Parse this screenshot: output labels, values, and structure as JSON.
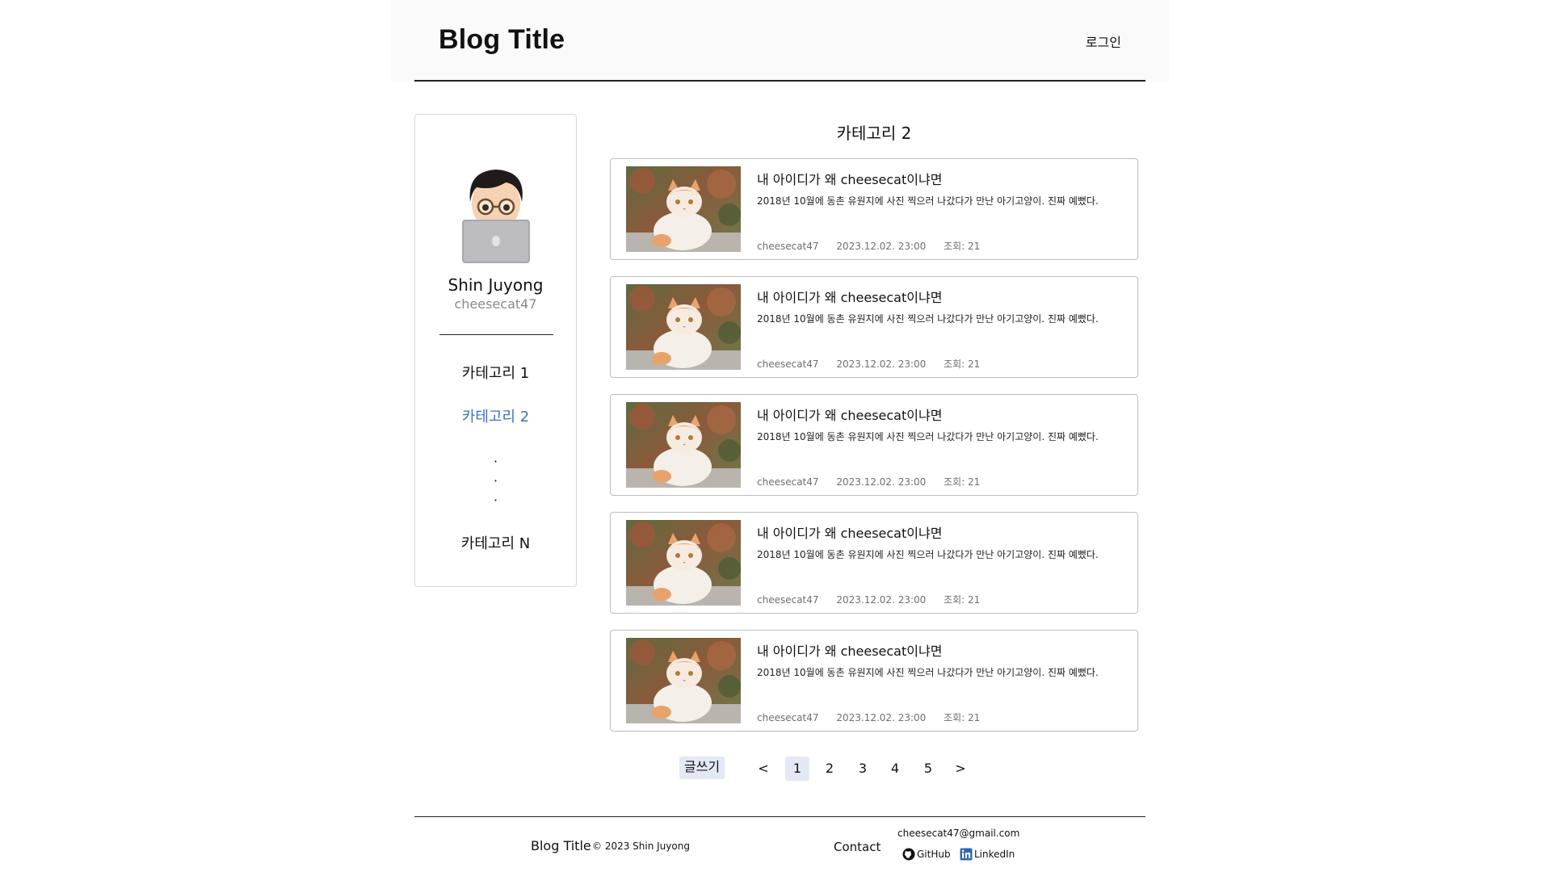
{
  "header": {
    "title": "Blog Title",
    "login_label": "로그인"
  },
  "sidebar": {
    "name": "Shin Juyong",
    "handle": "cheesecat47",
    "categories": [
      {
        "label": "카테고리 1",
        "active": false
      },
      {
        "label": "카테고리 2",
        "active": true
      },
      {
        "label": "카테고리 N",
        "active": false
      }
    ],
    "ellipsis": [
      "·",
      "·",
      "·"
    ]
  },
  "main": {
    "heading": "카테고리 2",
    "posts": [
      {
        "title": "내 아이디가 왜 cheesecat이냐면",
        "excerpt": "2018년 10월에 동촌 유원지에 사진 찍으러 나갔다가 만난 아기고양이. 진짜 예뻤다.",
        "author": "cheesecat47",
        "date": "2023.12.02. 23:00",
        "views": "조회: 21"
      },
      {
        "title": "내 아이디가 왜 cheesecat이냐면",
        "excerpt": "2018년 10월에 동촌 유원지에 사진 찍으러 나갔다가 만난 아기고양이. 진짜 예뻤다.",
        "author": "cheesecat47",
        "date": "2023.12.02. 23:00",
        "views": "조회: 21"
      },
      {
        "title": "내 아이디가 왜 cheesecat이냐면",
        "excerpt": "2018년 10월에 동촌 유원지에 사진 찍으러 나갔다가 만난 아기고양이. 진짜 예뻤다.",
        "author": "cheesecat47",
        "date": "2023.12.02. 23:00",
        "views": "조회: 21"
      },
      {
        "title": "내 아이디가 왜 cheesecat이냐면",
        "excerpt": "2018년 10월에 동촌 유원지에 사진 찍으러 나갔다가 만난 아기고양이. 진짜 예뻤다.",
        "author": "cheesecat47",
        "date": "2023.12.02. 23:00",
        "views": "조회: 21"
      },
      {
        "title": "내 아이디가 왜 cheesecat이냐면",
        "excerpt": "2018년 10월에 동촌 유원지에 사진 찍으러 나갔다가 만난 아기고양이. 진짜 예뻤다.",
        "author": "cheesecat47",
        "date": "2023.12.02. 23:00",
        "views": "조회: 21"
      }
    ]
  },
  "pagination": {
    "write_label": "글쓰기",
    "prev": "<",
    "next": ">",
    "pages": [
      "1",
      "2",
      "3",
      "4",
      "5"
    ],
    "current": "1"
  },
  "footer": {
    "brand": "Blog Title",
    "copyright": "© 2023 Shin Juyong",
    "contact_label": "Contact",
    "email": "cheesecat47@gmail.com",
    "github_label": "GitHub",
    "linkedin_label": "LinkedIn"
  },
  "colors": {
    "accent": "#3b6fc4",
    "highlight": "#e3e9f4",
    "header_bg": "#fafafa"
  }
}
